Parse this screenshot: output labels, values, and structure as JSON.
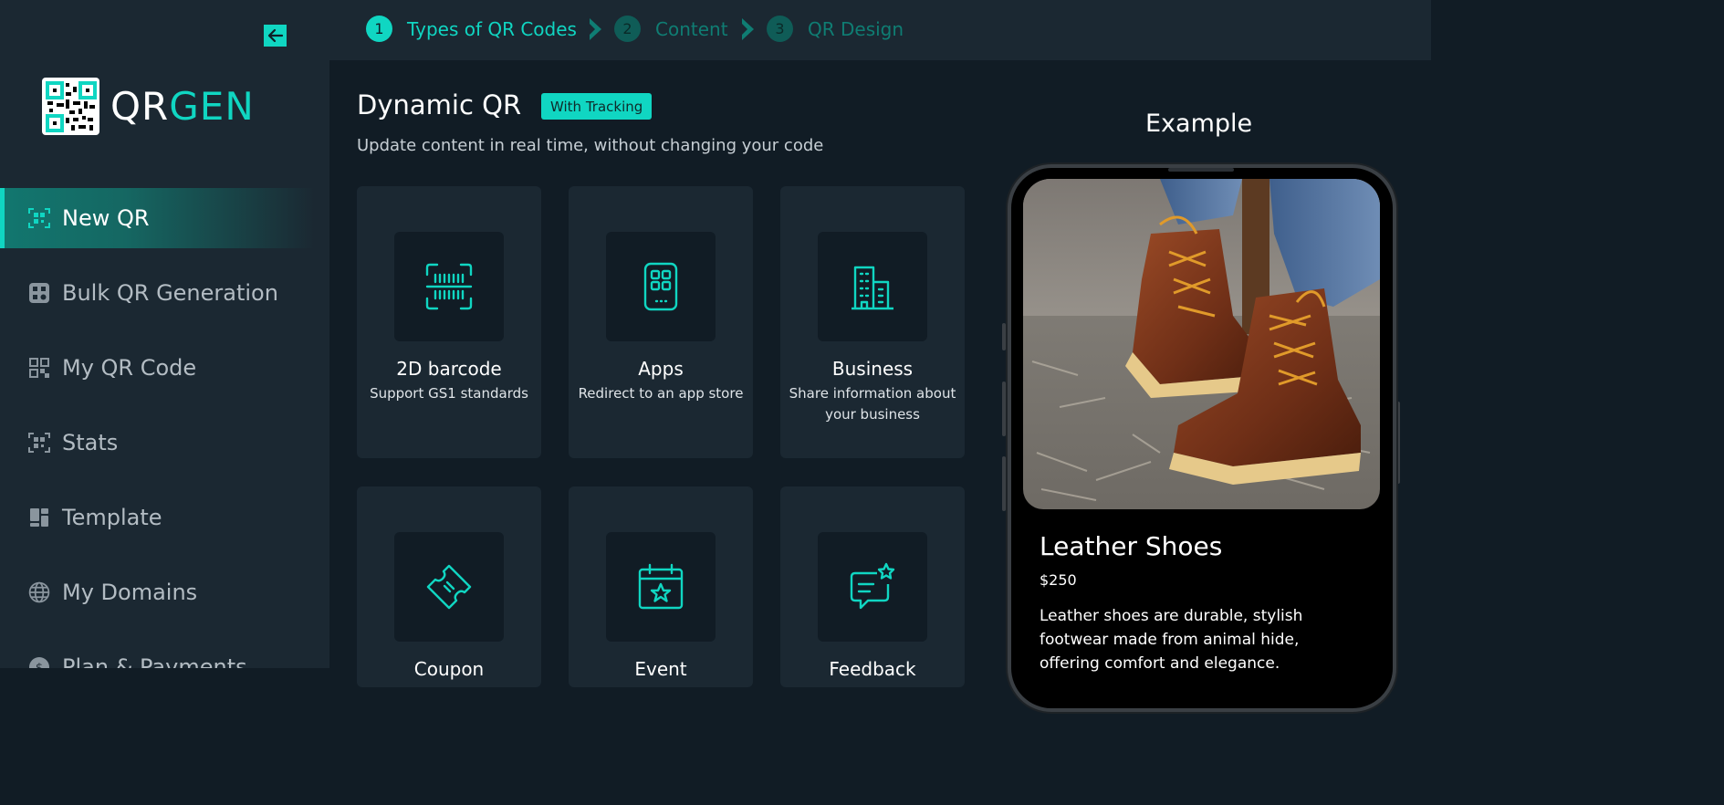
{
  "sidebar": {
    "logo": {
      "text_qr": "QR",
      "text_gen": "GEN"
    },
    "items": [
      {
        "label": "New QR",
        "icon": "scan-qr-icon",
        "active": true
      },
      {
        "label": "Bulk QR Generation",
        "icon": "bulk-grid-icon",
        "active": false
      },
      {
        "label": "My QR Code",
        "icon": "qr-code-icon",
        "active": false
      },
      {
        "label": "Stats",
        "icon": "stats-scan-icon",
        "active": false
      },
      {
        "label": "Template",
        "icon": "template-icon",
        "active": false
      },
      {
        "label": "My Domains",
        "icon": "globe-icon",
        "active": false
      },
      {
        "label": "Plan & Payments",
        "icon": "payment-icon",
        "active": false
      }
    ]
  },
  "stepper": {
    "steps": [
      {
        "number": "1",
        "label": "Types of QR Codes",
        "state": "current"
      },
      {
        "number": "2",
        "label": "Content",
        "state": "pending"
      },
      {
        "number": "3",
        "label": "QR Design",
        "state": "pending"
      }
    ]
  },
  "main": {
    "title": "Dynamic QR",
    "badge": "With Tracking",
    "subtitle": "Update content in real time, without changing your code",
    "cards": [
      {
        "title": "2D barcode",
        "desc": "Support GS1 standards",
        "icon": "barcode-scan-icon"
      },
      {
        "title": "Apps",
        "desc": "Redirect to an app store",
        "icon": "mobile-apps-icon"
      },
      {
        "title": "Business",
        "desc": "Share information about your business",
        "icon": "building-icon"
      },
      {
        "title": "Coupon",
        "desc": "",
        "icon": "ticket-icon"
      },
      {
        "title": "Event",
        "desc": "",
        "icon": "calendar-star-icon"
      },
      {
        "title": "Feedback",
        "desc": "",
        "icon": "chat-star-icon"
      }
    ]
  },
  "example": {
    "title": "Example",
    "product_name": "Leather Shoes",
    "price": "$250",
    "description": "Leather shoes are durable, stylish footwear made from animal hide, offering comfort and elegance."
  },
  "colors": {
    "accent": "#10d6c2",
    "sidebar_bg": "#1b2832",
    "page_bg": "#111c25",
    "card_bg": "#1b2832"
  }
}
